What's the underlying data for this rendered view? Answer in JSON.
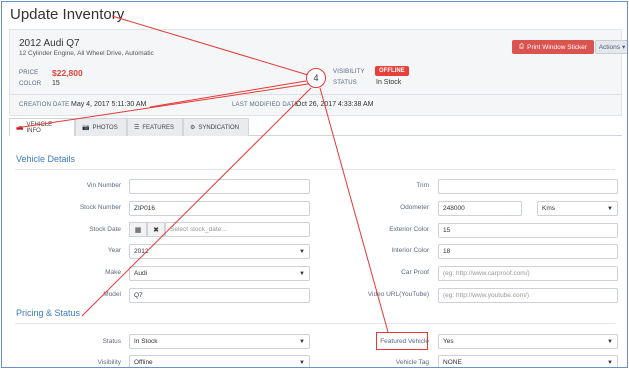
{
  "page": {
    "title": "Update Inventory"
  },
  "vehicle": {
    "title": "2012 Audi Q7",
    "subtitle": "12 Cylinder Engine, All Wheel Drive, Automatic",
    "price_label": "PRICE",
    "price": "$22,800",
    "color_label": "COLOR",
    "color": "15",
    "visibility_label": "VISIBILITY",
    "visibility": "OFFLINE",
    "status_label": "STATUS",
    "status": "In Stock",
    "creation_label": "CREATION DATE",
    "creation_date": "May 4, 2017 5:11:30 AM",
    "modified_label": "LAST MODIFIED DATE",
    "modified_date": "Oct 26, 2017 4:33:38 AM"
  },
  "buttons": {
    "print": "Print Window Sticker",
    "actions": "Actions"
  },
  "tabs": [
    {
      "label": "VEHICLE INFO",
      "icon": "car-icon"
    },
    {
      "label": "PHOTOS",
      "icon": "camera-icon"
    },
    {
      "label": "FEATURES",
      "icon": "list-icon"
    },
    {
      "label": "SYNDICATION",
      "icon": "gears-icon"
    }
  ],
  "sections": {
    "details": "Vehicle Details",
    "pricing": "Pricing & Status"
  },
  "fields": {
    "vin": {
      "label": "Vin Number",
      "value": ""
    },
    "stock_number": {
      "label": "Stock Number",
      "value": "ZIP016"
    },
    "stock_date": {
      "label": "Stock Date",
      "placeholder": "Select stock_date..."
    },
    "year": {
      "label": "Year",
      "value": "2012"
    },
    "make": {
      "label": "Make",
      "value": "Audi"
    },
    "model": {
      "label": "Model",
      "value": "Q7"
    },
    "trim": {
      "label": "Trim",
      "value": ""
    },
    "odometer": {
      "label": "Odometer",
      "value": "248000",
      "unit": "Kms"
    },
    "exterior_color": {
      "label": "Exterior Color",
      "value": "15"
    },
    "interior_color": {
      "label": "Interior Color",
      "value": "18"
    },
    "car_proof": {
      "label": "Car Proof",
      "placeholder": "(eg: http://www.carproof.com/)"
    },
    "video_url": {
      "label": "Video URL(YouTube)",
      "placeholder": "(eg: http://www.youtube.com/)"
    },
    "status": {
      "label": "Status",
      "value": "In Stock"
    },
    "visibility": {
      "label": "Visibility",
      "value": "Offline"
    },
    "featured": {
      "label": "Featured Vehicle",
      "value": "Yes"
    },
    "vehicle_tag": {
      "label": "Vehicle Tag",
      "value": "NONE"
    }
  },
  "annotation": {
    "number": "4"
  },
  "colors": {
    "accent": "#3a7bbf",
    "danger": "#e53935",
    "button_red": "#d9534f"
  }
}
